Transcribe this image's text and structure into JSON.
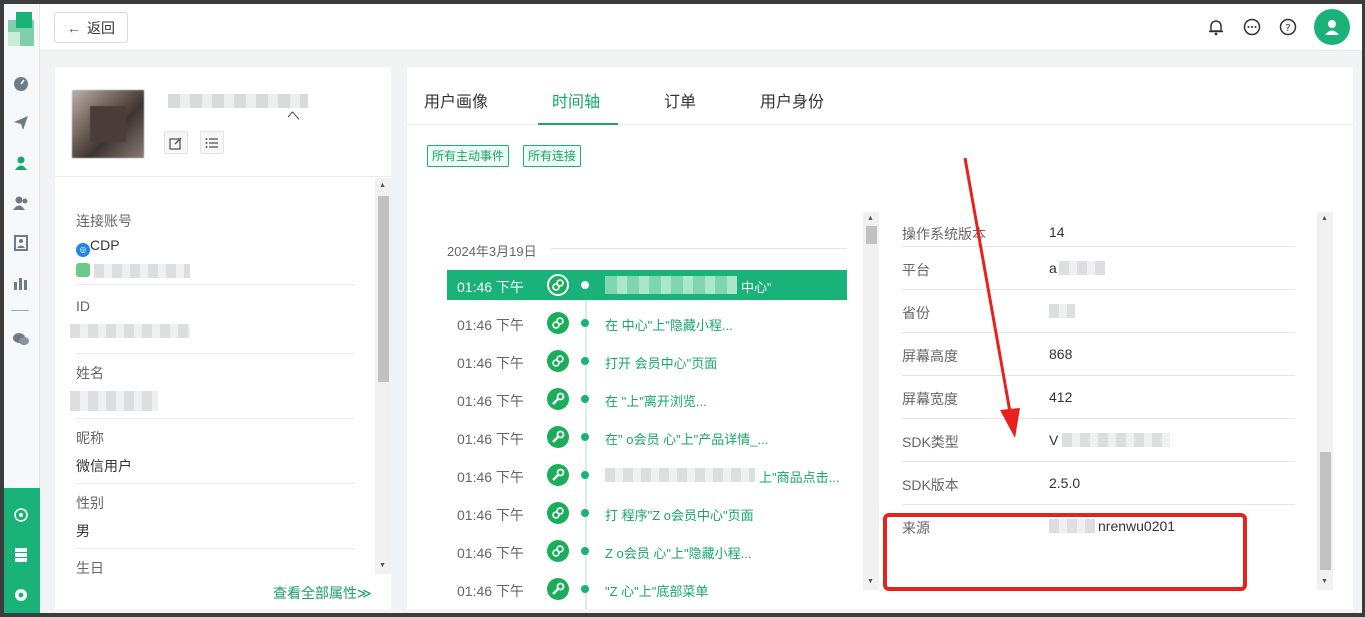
{
  "topbar": {
    "back_label": "返回",
    "icons": [
      "bell-icon",
      "chat-icon",
      "help-icon",
      "user-avatar-icon"
    ]
  },
  "rail": {
    "icons": [
      "dashboard-icon",
      "send-icon",
      "user-icon",
      "users-icon",
      "contact-card-icon",
      "bar-chart-icon",
      "wechat-icon"
    ],
    "bottom_icons": [
      "network-icon",
      "database-icon",
      "settings-icon"
    ]
  },
  "profile": {
    "name_suffix": "へ",
    "attributes": [
      {
        "label": "连接账号",
        "value": "CDP"
      },
      {
        "label": "ID",
        "value": ""
      },
      {
        "label": "姓名",
        "value": ""
      },
      {
        "label": "昵称",
        "value": "微信用户"
      },
      {
        "label": "性别",
        "value": "男"
      },
      {
        "label": "生日",
        "value": ""
      }
    ],
    "view_all": "查看全部属性≫"
  },
  "tabs": [
    {
      "label": "用户画像",
      "active": false
    },
    {
      "label": "时间轴",
      "active": true
    },
    {
      "label": "订单",
      "active": false
    },
    {
      "label": "用户身份",
      "active": false
    }
  ],
  "filters": [
    "所有主动事件",
    "所有连接"
  ],
  "timeline": {
    "date": "2024年3月19日",
    "events": [
      {
        "time": "01:46 下午",
        "icon": "miniprogram-icon",
        "text": "中心\"",
        "selected": true
      },
      {
        "time": "01:46 下午",
        "icon": "miniprogram-icon",
        "text": "在 中心\"上\"隐藏小程...",
        "selected": false
      },
      {
        "time": "01:46 下午",
        "icon": "miniprogram-icon",
        "text": "打开 会员中心\"页面",
        "selected": false
      },
      {
        "time": "01:46 下午",
        "icon": "wrench-icon",
        "text": "在 \"上\"离开浏览...",
        "selected": false
      },
      {
        "time": "01:46 下午",
        "icon": "wrench-icon",
        "text": "在\" o会员 心\"上\"产品详情_...",
        "selected": false
      },
      {
        "time": "01:46 下午",
        "icon": "wrench-icon",
        "text": "上\"商品点击...",
        "selected": false
      },
      {
        "time": "01:46 下午",
        "icon": "miniprogram-icon",
        "text": "打 程序\"Z o会员中心\"页面",
        "selected": false
      },
      {
        "time": "01:46 下午",
        "icon": "miniprogram-icon",
        "text": "Z o会员 心\"上\"隐藏小程...",
        "selected": false
      },
      {
        "time": "01:46 下午",
        "icon": "wrench-icon",
        "text": "\"Z 心\"上\"底部菜单",
        "selected": false
      }
    ]
  },
  "details": [
    {
      "key": "操作系统版本",
      "value": "14"
    },
    {
      "key": "平台",
      "value": "a"
    },
    {
      "key": "省份",
      "value": ""
    },
    {
      "key": "屏幕高度",
      "value": "868"
    },
    {
      "key": "屏幕宽度",
      "value": "412"
    },
    {
      "key": "SDK类型",
      "value": "V"
    },
    {
      "key": "SDK版本",
      "value": "2.5.0"
    },
    {
      "key": "来源",
      "value": "nrenwu0201"
    }
  ],
  "colors": {
    "accent": "#19b37a",
    "annotation": "#e8201e"
  }
}
